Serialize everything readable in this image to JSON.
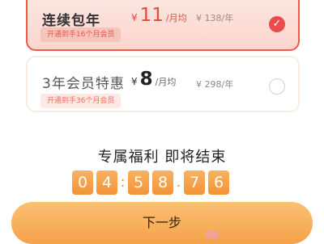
{
  "plans": [
    {
      "name": "连续包年",
      "currency": "¥",
      "price": "11",
      "unit": "/月均",
      "original": "¥ 138/年",
      "tag": "开通到手16个月会员",
      "selected": true
    },
    {
      "name": "3年会员特惠",
      "currency": "¥",
      "price": "8",
      "unit": "/月均",
      "original": "¥ 298/年",
      "tag": "开通到手36个月会员",
      "selected": false
    }
  ],
  "benefit": {
    "title": "专属福利 即将结束"
  },
  "countdown": {
    "digits": [
      "0",
      "4",
      "5",
      "8",
      "7",
      "6"
    ],
    "separators": [
      ":",
      ".",
      "."
    ]
  },
  "actions": {
    "next_label": "下一步"
  },
  "colors": {
    "accent": "#ef5a4d",
    "orange": "#f39437",
    "button": "#f7a94f"
  }
}
